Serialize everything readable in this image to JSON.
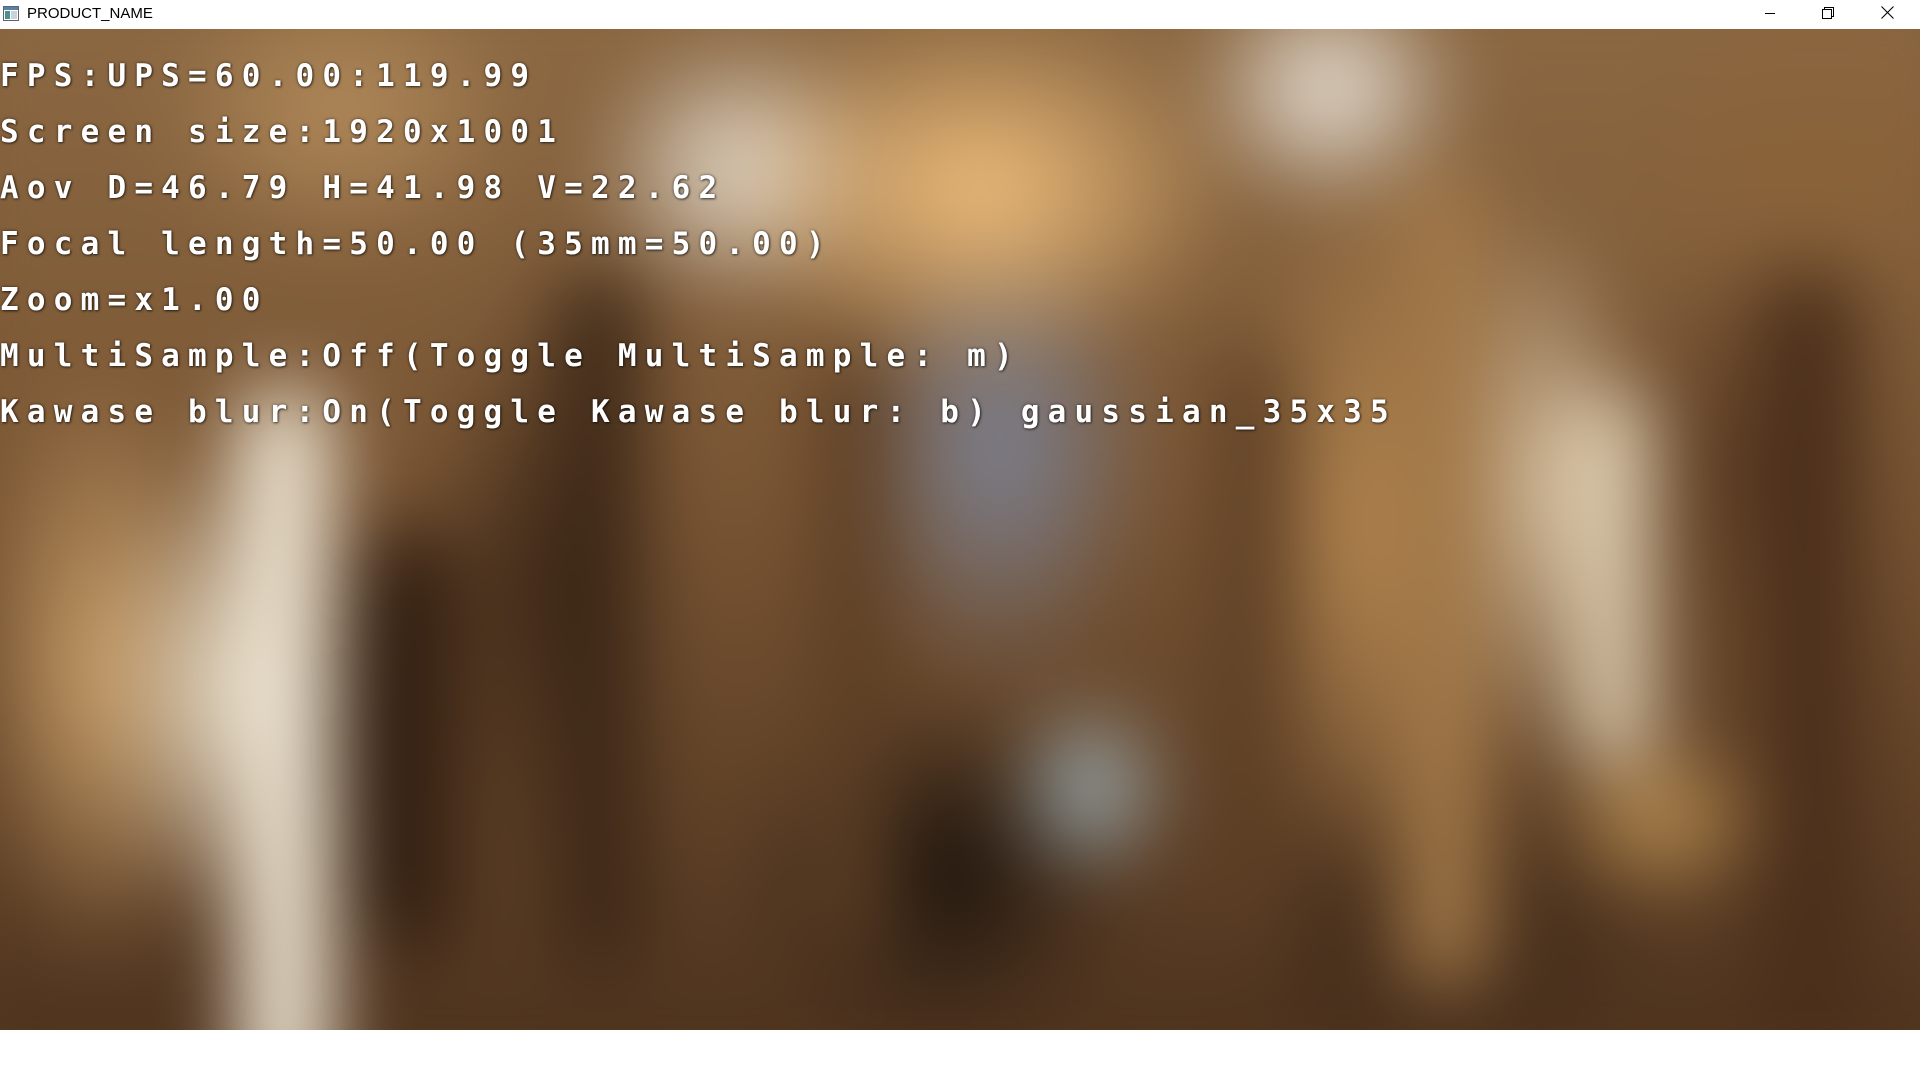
{
  "window": {
    "title": "PRODUCT_NAME",
    "icons": {
      "app": "app-window-icon",
      "minimize": "minimize-icon",
      "restore": "restore-icon",
      "close": "close-icon"
    }
  },
  "hud": {
    "lines": [
      "FPS:UPS=60.00:119.99",
      "Screen size:1920x1001",
      "Aov D=46.79 H=41.98 V=22.62",
      "Focal length=50.00 (35mm=50.00)",
      "Zoom=x1.00",
      "MultiSample:Off(Toggle MultiSample: m)",
      "Kawase blur:On(Toggle Kawase blur: b) gaussian_35x35"
    ]
  }
}
